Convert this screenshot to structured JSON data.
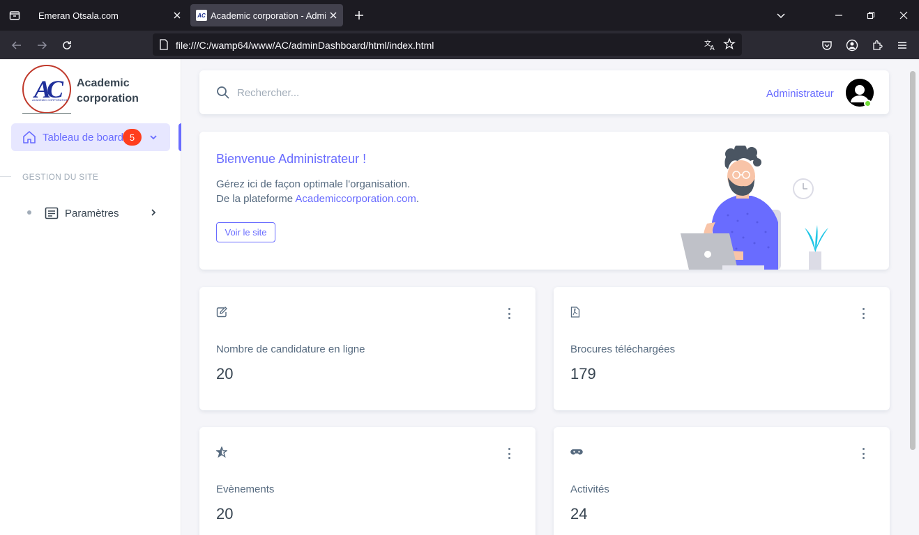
{
  "browser": {
    "tabs": [
      {
        "title": "Emeran Otsala.com",
        "active": false
      },
      {
        "title": "Academic corporation - Admin",
        "active": true
      }
    ],
    "favicon_text": "AC",
    "url": "file:///C:/wamp64/www/AC/adminDashboard/html/index.html"
  },
  "sidebar": {
    "logo_letters_a": "A",
    "logo_letters_c": "C",
    "logo_sub": "ACADEMIC CORPORATION",
    "brand_line1": "Academic",
    "brand_line2": "corporation",
    "active_item": {
      "label": "Tableau de board",
      "badge": "5"
    },
    "section_title": "GESTION DU SITE",
    "items": [
      {
        "label": "Paramètres"
      }
    ]
  },
  "topbar": {
    "search_placeholder": "Rechercher...",
    "user_name": "Administrateur"
  },
  "welcome": {
    "title": "Bienvenue Administrateur !",
    "line1": "Gérez ici de façon optimale l'organisation.",
    "line2_prefix": "De la plateforme ",
    "line2_link": "Academiccorporation.com",
    "line2_suffix": ".",
    "button": "Voir le site"
  },
  "stats": [
    {
      "label": "Nombre de candidature en ligne",
      "value": "20",
      "icon": "edit-icon"
    },
    {
      "label": "Brocures téléchargées",
      "value": "179",
      "icon": "pdf-icon"
    },
    {
      "label": "Evènements",
      "value": "20",
      "icon": "star-icon"
    },
    {
      "label": "Activités",
      "value": "24",
      "icon": "gamepad-icon"
    }
  ],
  "colors": {
    "primary": "#696cff",
    "badge": "#ff3e1d",
    "online": "#71dd37",
    "text": "#566a7f"
  }
}
